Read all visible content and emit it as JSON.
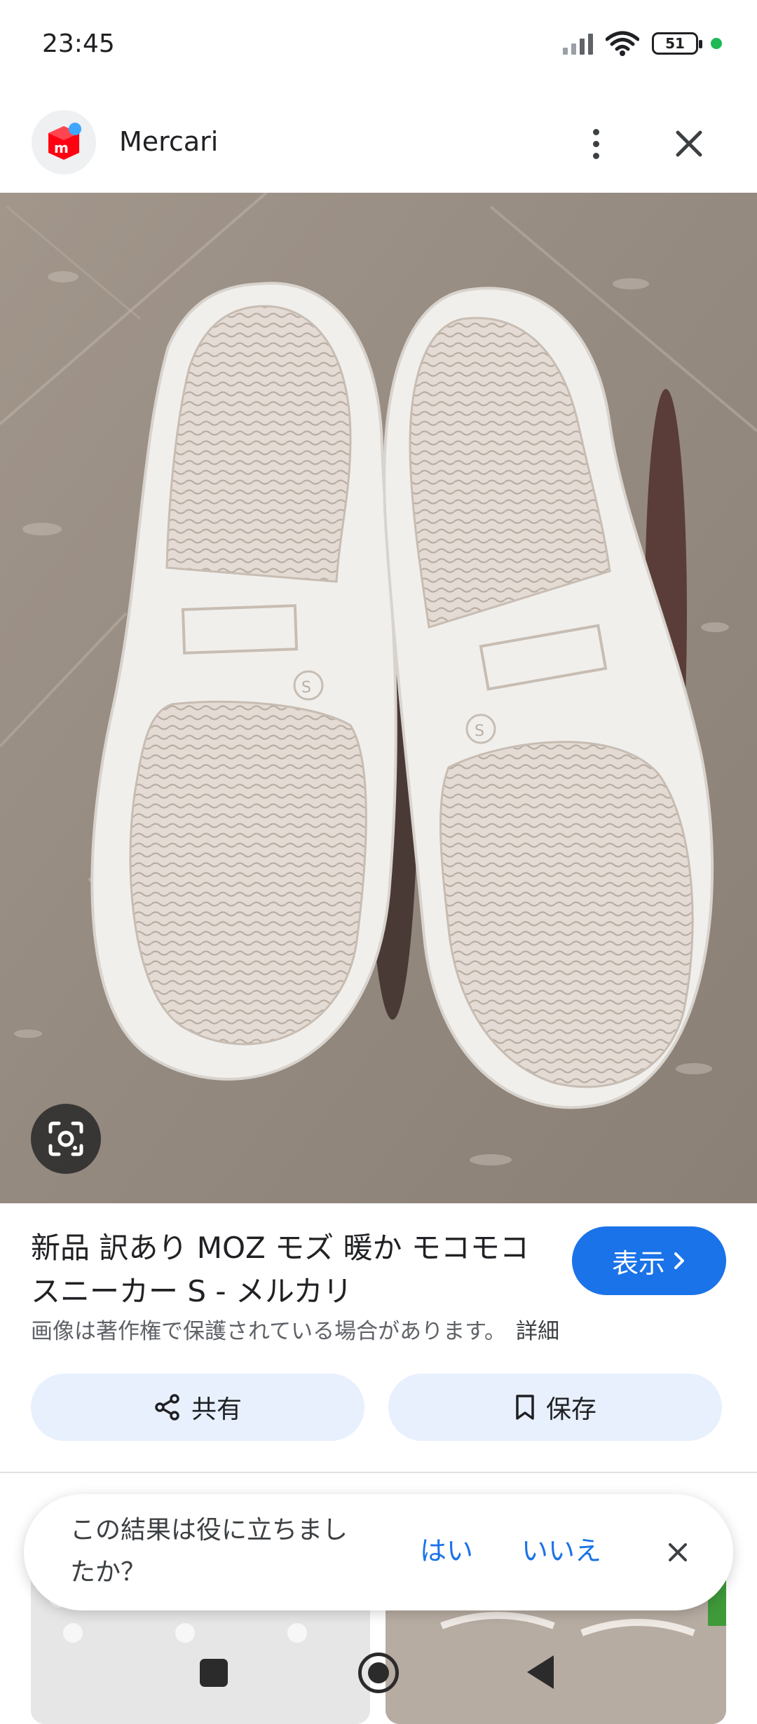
{
  "status_bar": {
    "time": "23:45",
    "battery": "51",
    "icons": [
      "signal-icon",
      "wifi-icon",
      "battery-icon",
      "privacy-indicator-dot"
    ]
  },
  "source": {
    "name": "Mercari",
    "logo_icon": "mercari-logo-icon",
    "more_icon": "more-vert-icon",
    "close_icon": "close-icon"
  },
  "image": {
    "lens_icon": "google-lens-icon"
  },
  "result": {
    "title_line1": "新品 訳あり MOZ モズ 暖か モコモコ",
    "title_line2": "スニーカー S - メルカリ",
    "visit_label": "表示",
    "copyright_notice": "画像は著作権で保護されている場合があります。",
    "details_link": "詳細"
  },
  "actions": {
    "share_label": "共有",
    "save_label": "保存"
  },
  "feedback": {
    "question_line1": "この結果は役に立ちまし",
    "question_line2": "たか？",
    "yes_label": "はい",
    "no_label": "いいえ"
  },
  "colors": {
    "accent": "#1a73e8",
    "pill_bg": "#e8f0fe",
    "mercari_red": "#ff0211"
  }
}
